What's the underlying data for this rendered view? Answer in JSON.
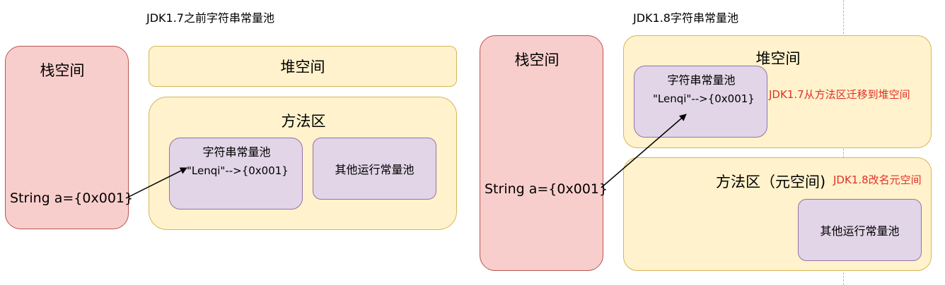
{
  "left": {
    "title": "JDK1.7之前字符串常量池",
    "stack_label": "栈空间",
    "stack_var": "String a={0x001}",
    "heap_label": "堆空间",
    "method_area_label": "方法区",
    "pool_title": "字符串常量池",
    "pool_entry": "\"Lenqi\"-->{0x001}",
    "runtime_pool": "其他运行常量池"
  },
  "right": {
    "title": "JDK1.8字符串常量池",
    "stack_label": "栈空间",
    "stack_var": "String a={0x001}",
    "heap_label": "堆空间",
    "pool_title": "字符串常量池",
    "pool_entry": "\"Lenqi\"-->{0x001}",
    "moved_note": "JDK1.7从方法区迁移到堆空间",
    "method_area_label": "方法区（元空间)",
    "renamed_note": "JDK1.8改名元空间",
    "runtime_pool": "其他运行常量池"
  },
  "colors": {
    "stack_fill": "#f8cecc",
    "stack_border": "#b85450",
    "area_fill": "#fff2cc",
    "area_border": "#d6b656",
    "pool_fill": "#e1d5e7",
    "pool_border": "#9673a6",
    "note": "#e0302a"
  }
}
